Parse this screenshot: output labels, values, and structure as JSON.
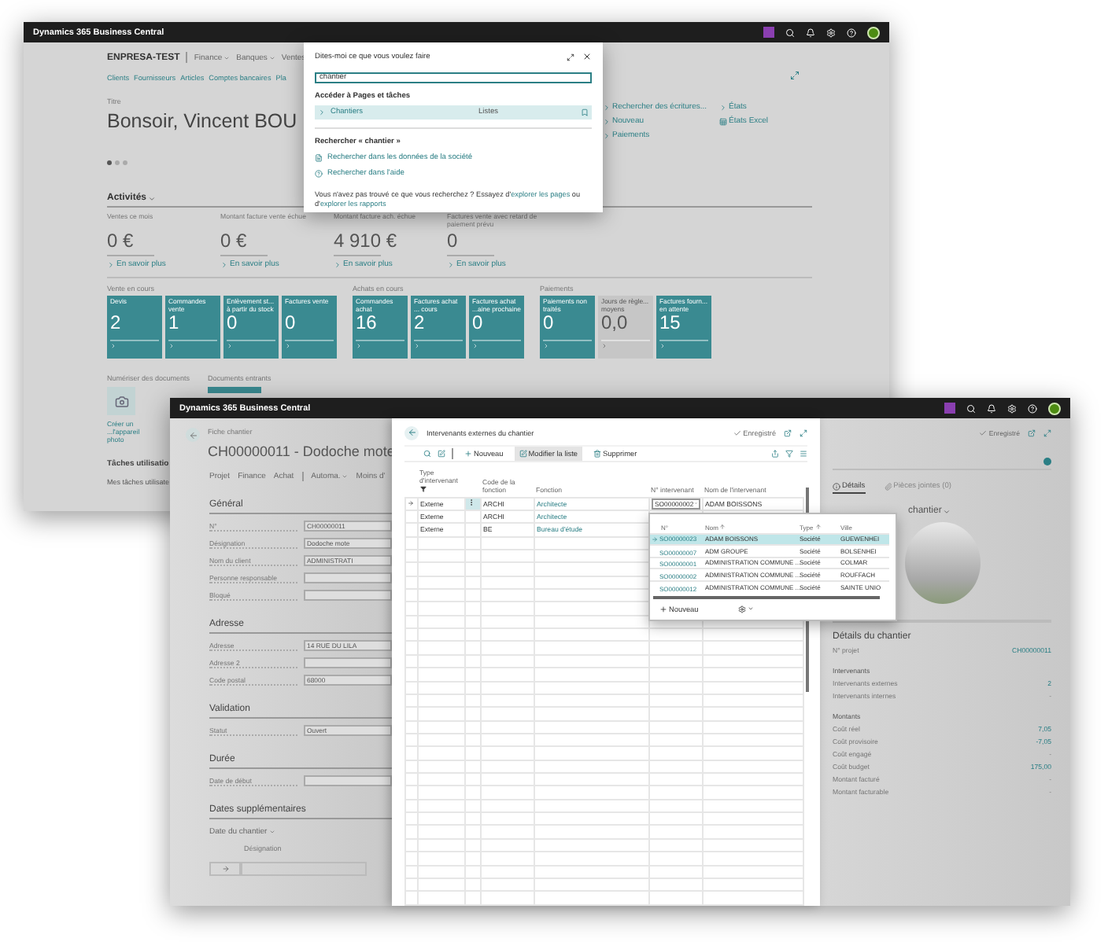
{
  "back_window": {
    "app_title": "Dynamics 365 Business Central",
    "company": "ENPRESA-TEST",
    "menus": [
      {
        "label": "Finance",
        "caret": true
      },
      {
        "label": "Banques",
        "caret": true
      },
      {
        "label": "Ventes",
        "caret": false
      }
    ],
    "links": [
      "Clients",
      "Fournisseurs",
      "Articles",
      "Comptes bancaires",
      "Pla"
    ],
    "title_label": "Titre",
    "greeting": "Bonsoir, Vincent BOU",
    "page_dots": [
      {
        "selected": true
      },
      {
        "selected": false
      },
      {
        "selected": false
      }
    ],
    "actions": [
      {
        "label": "Rechercher des écritures...",
        "kind": "chevron"
      },
      {
        "label": "Nouveau",
        "kind": "chevron"
      },
      {
        "label": "Paiements",
        "kind": "chevron"
      }
    ],
    "reports": [
      {
        "label": "États",
        "kind": "chevron"
      },
      {
        "label": "États Excel",
        "kind": "sheet"
      }
    ],
    "activities_title": "Activités",
    "kpis": [
      {
        "label": "Ventes ce mois",
        "value": "0 €",
        "link": "En savoir plus"
      },
      {
        "label": "Montant facture vente échue",
        "value": "0 €",
        "link": "En savoir plus"
      },
      {
        "label": "Montant facture ach. échue",
        "value": "4 910 €",
        "link": "En savoir plus"
      },
      {
        "label": "Factures vente avec retard de paiement prévu",
        "value": "0",
        "link": "En savoir plus"
      }
    ],
    "tile_groups": [
      {
        "title": "Vente en cours",
        "tiles": [
          {
            "label": "Devis",
            "value": "2",
            "muted": false
          },
          {
            "label": "Commandes vente",
            "value": "1",
            "muted": false
          },
          {
            "label": "Enlèvement st... à partir du stock",
            "value": "0",
            "muted": false
          },
          {
            "label": "Factures vente",
            "value": "0",
            "muted": false
          }
        ]
      },
      {
        "title": "Achats en cours",
        "tiles": [
          {
            "label": "Commandes achat",
            "value": "16",
            "muted": false
          },
          {
            "label": "Factures achat ... cours",
            "value": "2",
            "muted": false
          },
          {
            "label": "Factures achat ...aine prochaine",
            "value": "0",
            "muted": false
          }
        ]
      },
      {
        "title": "Paiements",
        "tiles": [
          {
            "label": "Paiements non traités",
            "value": "0",
            "muted": false
          },
          {
            "label": "Jours de règle... moyens",
            "value": "0,0",
            "muted": true
          },
          {
            "label": "Factures fourn... en attente",
            "value": "15",
            "muted": false
          }
        ]
      }
    ],
    "scan": {
      "title": "Numériser des documents",
      "link": "Créer un ...l'appareil photo"
    },
    "incoming": {
      "title": "Documents entrants"
    },
    "tasks": {
      "title": "Tâches utilisatio",
      "link": "Mes tâches utilisate"
    }
  },
  "search_dialog": {
    "title": "Dites-moi ce que vous voulez faire",
    "query": "chantier",
    "section_pages": "Accéder à Pages et tâches",
    "results": [
      {
        "label": "Chantiers",
        "category": "Listes",
        "selected": true
      }
    ],
    "section_search": "Rechercher « chantier »",
    "search_options": [
      {
        "label": "Rechercher dans les données de la société",
        "kind": "data"
      },
      {
        "label": "Rechercher dans l'aide",
        "kind": "help"
      }
    ],
    "footer": [
      {
        "text": "Vous n'avez pas trouvé ce que vous recherchez ? Essayez d'",
        "link": false
      },
      {
        "text": "explorer les pages",
        "link": true
      },
      {
        "text": " ou d'",
        "link": false
      },
      {
        "text": "explorer les rapports",
        "link": true
      }
    ]
  },
  "front_window": {
    "app_title": "Dynamics 365 Business Central",
    "form": {
      "breadcrumb": "Fiche chantier",
      "title": "CH00000011 - Dodoche mote",
      "actions": [
        {
          "label": "Projet",
          "caret": false,
          "separator_before": false
        },
        {
          "label": "Finance",
          "caret": false,
          "separator_before": false
        },
        {
          "label": "Achat",
          "caret": false,
          "separator_before": false
        },
        {
          "label": "Automa.",
          "caret": true,
          "separator_before": true
        },
        {
          "label": "Moins d'",
          "caret": false,
          "separator_before": false
        }
      ],
      "sections": [
        {
          "title": "Général",
          "fields": [
            {
              "label": "N°",
              "value": "CH00000011"
            },
            {
              "label": "Désignation",
              "value": "Dodoche mote"
            },
            {
              "label": "Nom du client",
              "value": "ADMINISTRATI"
            },
            {
              "label": "Personne responsable"
            },
            {
              "label": "Bloqué"
            }
          ]
        },
        {
          "title": "Adresse",
          "fields": [
            {
              "label": "Adresse",
              "value": "14 RUE DU LILA"
            },
            {
              "label": "Adresse 2"
            },
            {
              "label": "Code postal",
              "value": "68000"
            }
          ]
        },
        {
          "title": "Validation",
          "fields": [
            {
              "label": "Statut",
              "value": "Ouvert"
            }
          ]
        },
        {
          "title": "Durée",
          "fields": [
            {
              "label": "Date de début"
            }
          ]
        }
      ],
      "extra_dates": {
        "title": "Dates supplémentaires",
        "filter": "Date du chantier",
        "column": "Désignation"
      }
    },
    "list": {
      "title": "Intervenants externes du chantier",
      "status": "Enregistré",
      "toolbar": [
        {
          "label": "Nouveau",
          "kind": "new",
          "selected": false
        },
        {
          "label": "Modifier la liste",
          "kind": "edit",
          "selected": true
        },
        {
          "label": "Supprimer",
          "kind": "delete",
          "selected": false
        }
      ],
      "columns": [
        "Type d'intervenant",
        "Code de la fonction",
        "Fonction",
        "N° intervenant",
        "Nom de l'intervenant"
      ],
      "rows": [
        {
          "type": "Externe",
          "code": "ARCHI",
          "function": "Architecte",
          "number": "SO00000002",
          "name": "ADAM BOISSONS",
          "selected": true
        },
        {
          "type": "Externe",
          "code": "ARCHI",
          "function": "Architecte",
          "selected": false
        },
        {
          "type": "Externe",
          "code": "BE",
          "function": "Bureau d'étude",
          "selected": false
        }
      ]
    },
    "lookup": {
      "columns": [
        {
          "label": "N°",
          "sorted": false
        },
        {
          "label": "Nom",
          "sorted": true
        },
        {
          "label": "Type",
          "sorted": true
        },
        {
          "label": "Ville",
          "sorted": false
        }
      ],
      "rows": [
        {
          "number": "SO00000023",
          "name": "ADAM BOISSONS",
          "type": "Société",
          "city": "GUEWENHEI",
          "selected": true
        },
        {
          "number": "SO00000007",
          "name": "ADM GROUPE",
          "type": "Société",
          "city": "BOLSENHEI",
          "selected": false
        },
        {
          "number": "SO00000001",
          "name": "ADMINISTRATION COMMUNE ...",
          "type": "Société",
          "city": "COLMAR",
          "selected": false
        },
        {
          "number": "SO00000002",
          "name": "ADMINISTRATION COMMUNE ...",
          "type": "Société",
          "city": "ROUFFACH",
          "selected": false
        },
        {
          "number": "SO00000012",
          "name": "ADMINISTRATION COMMUNE ...",
          "type": "Société",
          "city": "SAINTE UNIO",
          "selected": false
        }
      ],
      "new_label": "Nouveau"
    },
    "factbox": {
      "status": "Enregistré",
      "tabs": [
        {
          "label": "Détails",
          "kind": "info",
          "selected": true
        },
        {
          "label": "Pièces jointes (0)",
          "kind": "attach",
          "selected": false
        }
      ],
      "heading": "chantier",
      "details_title": "Détails du chantier",
      "groups": [
        {
          "rows": [
            {
              "label": "N° projet",
              "value": "CH00000011",
              "linked": true
            }
          ]
        },
        {
          "title": "Intervenants",
          "rows": [
            {
              "label": "Intervenants externes",
              "value": "2",
              "linked": true
            },
            {
              "label": "Intervenants internes",
              "value": "-",
              "linked": false
            }
          ]
        },
        {
          "title": "Montants",
          "rows": [
            {
              "label": "Coût réel",
              "value": "7,05",
              "linked": true
            },
            {
              "label": "Coût provisoire",
              "value": "-7,05",
              "linked": true
            },
            {
              "label": "Coût engagé",
              "value": "-",
              "linked": false
            },
            {
              "label": "Coût budget",
              "value": "175,00",
              "linked": true
            },
            {
              "label": "Montant facturé",
              "value": "-",
              "linked": false
            },
            {
              "label": "Montant facturable",
              "value": "-",
              "linked": false
            }
          ]
        }
      ]
    }
  }
}
